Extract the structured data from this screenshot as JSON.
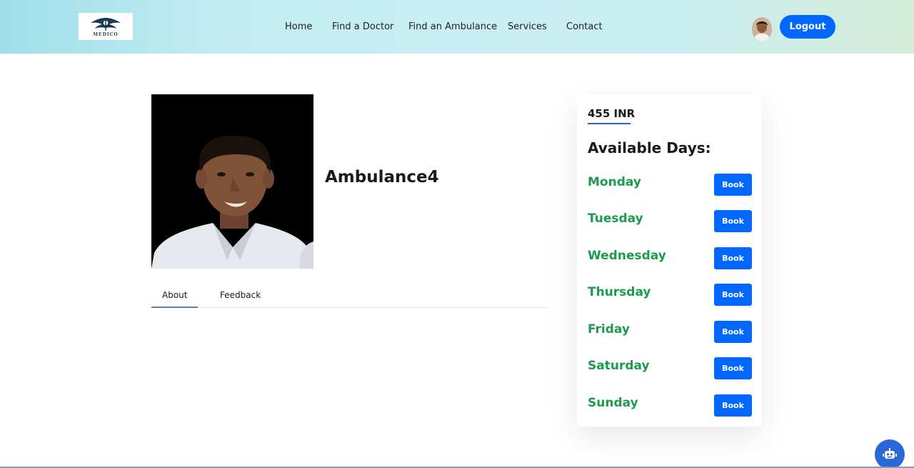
{
  "header": {
    "logo_text": "MEDICO",
    "nav": [
      {
        "label": "Home"
      },
      {
        "label": "Find a Doctor"
      },
      {
        "label": "Find an Ambulance"
      },
      {
        "label": "Services"
      },
      {
        "label": "Contact"
      }
    ],
    "logout_label": "Logout"
  },
  "profile": {
    "name": "Ambulance4",
    "tabs": [
      {
        "label": "About",
        "active": true
      },
      {
        "label": "Feedback",
        "active": false
      }
    ]
  },
  "booking": {
    "price": "455 INR",
    "days_title": "Available Days:",
    "book_label": "Book",
    "days": [
      {
        "day": "Monday"
      },
      {
        "day": "Tuesday"
      },
      {
        "day": "Wednesday"
      },
      {
        "day": "Thursday"
      },
      {
        "day": "Friday"
      },
      {
        "day": "Saturday"
      },
      {
        "day": "Sunday"
      }
    ]
  },
  "colors": {
    "primary": "#0067ff",
    "day_green": "#1c9b4c",
    "header_gradient_start": "#9fdfe9",
    "header_gradient_end": "#d4ecd9"
  },
  "icons": {
    "logo": "medico-logo-icon",
    "chatbot": "robot-icon"
  }
}
